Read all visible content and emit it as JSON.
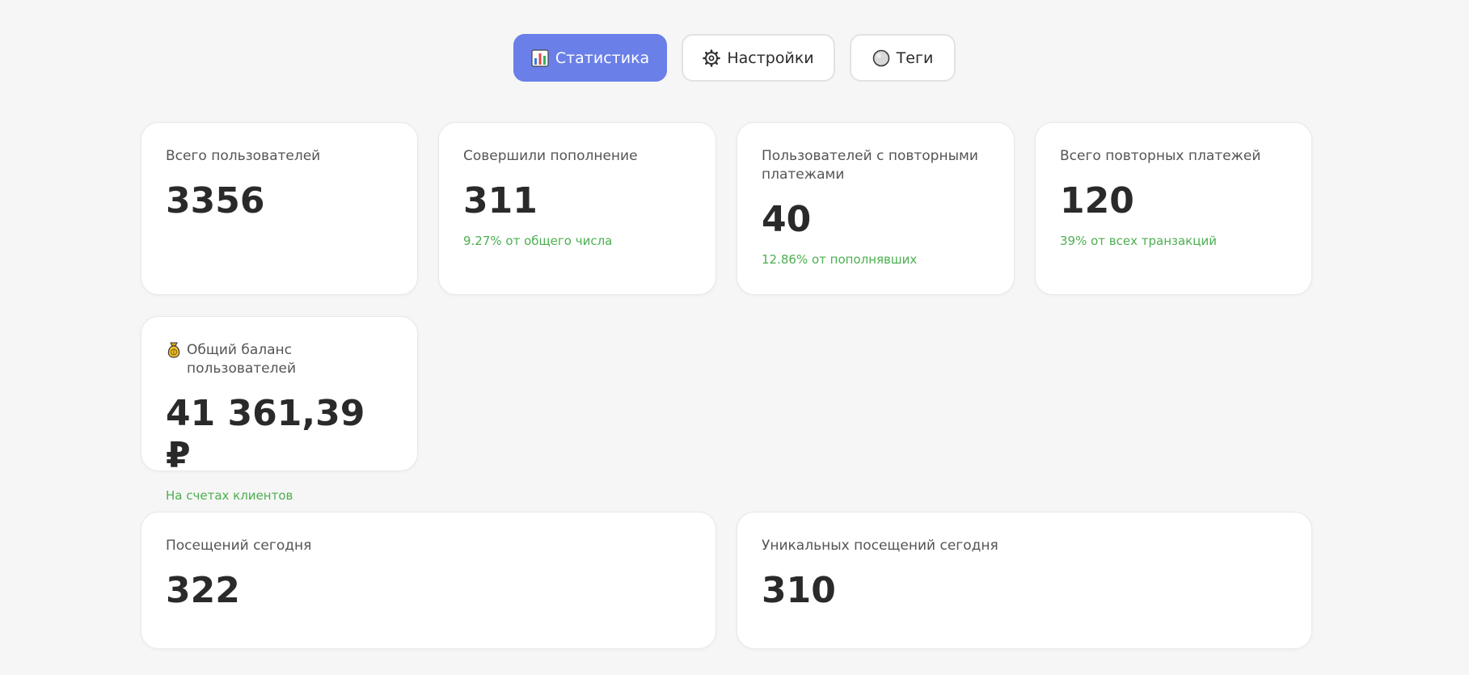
{
  "tabs": [
    {
      "label": "Статистика",
      "icon": "bar-chart-icon",
      "active": true
    },
    {
      "label": "Настройки",
      "icon": "gear-icon",
      "active": false
    },
    {
      "label": "Теги",
      "icon": "circle-icon",
      "active": false
    }
  ],
  "colors": {
    "accent": "#6a7fe8",
    "positive": "#4caf50",
    "background": "#f6f6f6"
  },
  "stats": {
    "total_users": {
      "label": "Всего пользователей",
      "value": "3356"
    },
    "deposited": {
      "label": "Совершили пополнение",
      "value": "311",
      "sub": "9.27% от общего числа"
    },
    "repeat_users": {
      "label": "Пользователей с повторными платежами",
      "value": "40",
      "sub": "12.86% от пополнявших"
    },
    "repeat_payments": {
      "label": "Всего повторных платежей",
      "value": "120",
      "sub": "39% от всех транзакций"
    },
    "balance": {
      "label": "Общий баланс пользователей",
      "icon": "money-bag-icon",
      "value": "41 361,39 ₽",
      "sub": "На счетах клиентов"
    },
    "visits_today": {
      "label": "Посещений сегодня",
      "value": "322"
    },
    "unique_visits_today": {
      "label": "Уникальных посещений сегодня",
      "value": "310"
    }
  }
}
